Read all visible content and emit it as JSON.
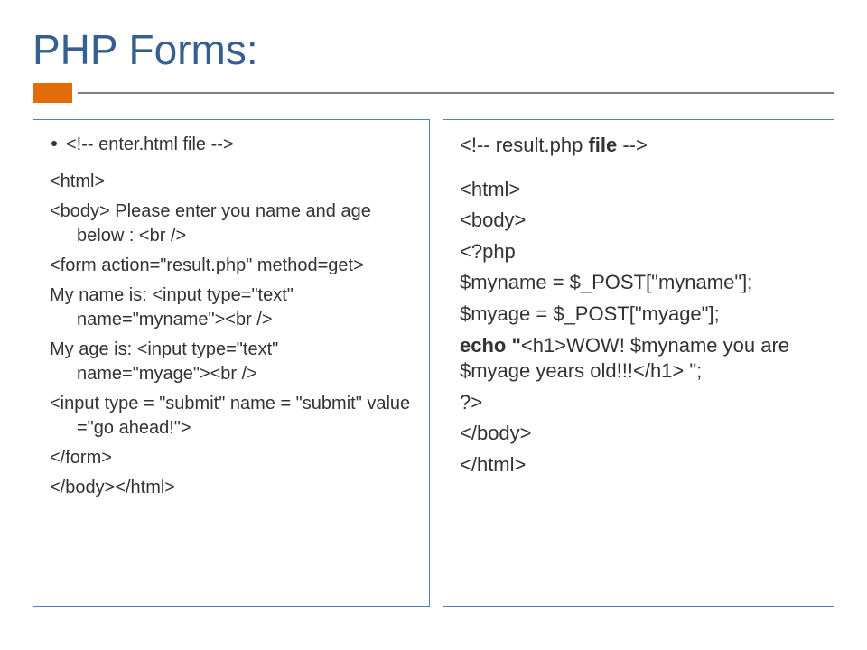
{
  "title": "PHP Forms:",
  "left": {
    "bullet": "<!-- enter.html file -->",
    "l1": "<html>",
    "l2": "<body>     Please enter you name and age below : <br />",
    "l3": "<form action=\"result.php\" method=get>",
    "l4": "My name is:   <input type=\"text\" name=\"myname\"><br />",
    "l5": " My age is:   <input type=\"text\" name=\"myage\"><br />",
    "l6": "<input type = \"submit\" name = \"submit\" value =\"go ahead!\">",
    "l7": "</form>",
    "l8": "</body></html>"
  },
  "right": {
    "r1a": "<!-- result.php ",
    "r1b": "file",
    "r1c": " -->",
    "r2": "<html>",
    "r3": "<body>",
    "r4": "<?php",
    "r5": "$myname = $_POST[\"myname\"];",
    "r6": "$myage = $_POST[\"myage\"];",
    "r7a": "echo \"",
    "r7b": "<h1>WOW! $myname you are $myage years old!!!</h1> \";",
    "r8": "?>",
    "r9": "</body>",
    "r10": "</html>"
  }
}
